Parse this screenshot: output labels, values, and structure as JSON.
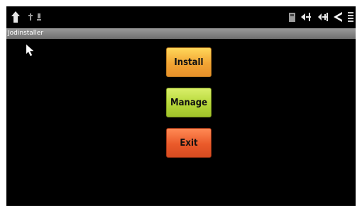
{
  "status_bar": {
    "left_icons": [
      "home-icon",
      "usb-icon",
      "notification-icon"
    ],
    "right_icons": [
      "sd-card-icon",
      "volume-down-icon",
      "volume-up-icon",
      "back-icon",
      "menu-icon"
    ]
  },
  "title_bar": {
    "title": "Jodinstaller"
  },
  "buttons": {
    "install_label": "Install",
    "manage_label": "Manage",
    "exit_label": "Exit"
  },
  "colors": {
    "install": "#f2a534",
    "manage": "#b7d83a",
    "exit": "#ea5a2a",
    "background": "#000000",
    "title_bar": "#8a8a8a"
  }
}
